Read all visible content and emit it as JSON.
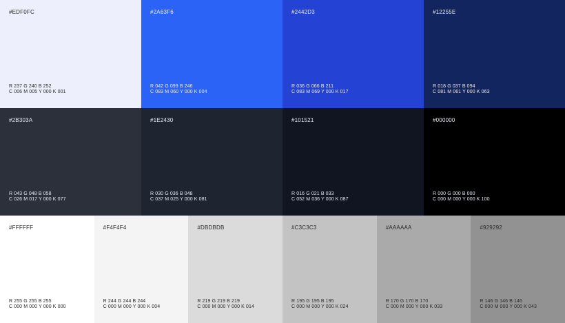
{
  "rows": [
    [
      {
        "hex": "#EDF0FC",
        "rgb": "R 237   G 240  B 252",
        "cmyk": "C 006   M 005  Y 000   K 001",
        "color": "#EDF0FC",
        "tone": "light"
      },
      {
        "hex": "#2A63F6",
        "rgb": "R 042   G 099   B 246",
        "cmyk": "C 083   M 060  Y 000   K 004",
        "color": "#2A63F6",
        "tone": "dark"
      },
      {
        "hex": "#2442D3",
        "rgb": "R 036   G 066  B 211",
        "cmyk": "C 083   M 069  Y 000   K 017",
        "color": "#2442D3",
        "tone": "dark"
      },
      {
        "hex": "#12255E",
        "rgb": "R 018   G 037   B 094",
        "cmyk": "C 081   M 061   Y 000   K 063",
        "color": "#12255E",
        "tone": "dark"
      }
    ],
    [
      {
        "hex": "#2B303A",
        "rgb": "R 043   G 048   B 058",
        "cmyk": "C 026   M 017   Y 000   K 077",
        "color": "#2B303A",
        "tone": "dark"
      },
      {
        "hex": "#1E2430",
        "rgb": "R 030   G 036   B 048",
        "cmyk": "C 037   M 025  Y 000   K 081",
        "color": "#1E2430",
        "tone": "dark"
      },
      {
        "hex": "#101521",
        "rgb": "R 016   G 021   B 033",
        "cmyk": "C 052   M 036 Y 000  K 087",
        "color": "#101521",
        "tone": "dark"
      },
      {
        "hex": "#000000",
        "rgb": "R 000   G 000  B 000",
        "cmyk": "C 000   M 000   Y 000   K 100",
        "color": "#000000",
        "tone": "dark"
      }
    ],
    [
      {
        "hex": "#FFFFFF",
        "rgb": "R 255    G 255   B 255",
        "cmyk": "C 000   M 000   Y 000   K 000",
        "color": "#FFFFFF",
        "tone": "light"
      },
      {
        "hex": "#F4F4F4",
        "rgb": "R 244    G 244  B 244",
        "cmyk": "C 000   M 000 Y 000  K 004",
        "color": "#F4F4F4",
        "tone": "light"
      },
      {
        "hex": "#DBDBDB",
        "rgb": "R 219    G 219    B 219",
        "cmyk": "C 000    M 000   Y 000   K 014",
        "color": "#DBDBDB",
        "tone": "light"
      },
      {
        "hex": "#C3C3C3",
        "rgb": "R 195    G 195   B 195",
        "cmyk": "C 000   M 000   Y 000   K 024",
        "color": "#C3C3C3",
        "tone": "light"
      },
      {
        "hex": "#AAAAAA",
        "rgb": "R 170   G 170   B 170",
        "cmyk": "C 000  M 000  Y 000   K 033",
        "color": "#AAAAAA",
        "tone": "light"
      },
      {
        "hex": "#929292",
        "rgb": "R 146    G 146   B 146",
        "cmyk": "C 000   M 000   Y 000   K 043",
        "color": "#929292",
        "tone": "light"
      }
    ]
  ]
}
